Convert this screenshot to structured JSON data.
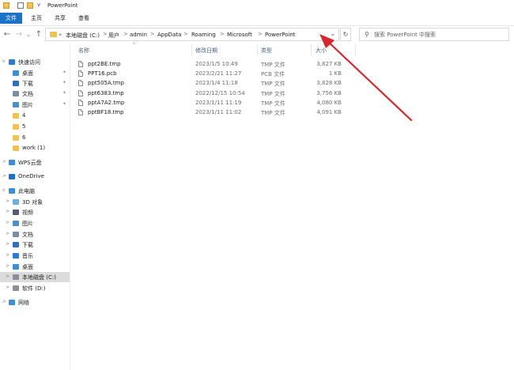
{
  "window": {
    "title": "PowerPoint",
    "qat_overflow": "v"
  },
  "ribbon": {
    "tabs": [
      {
        "label": "文件",
        "active": true
      },
      {
        "label": "主页",
        "active": false
      },
      {
        "label": "共享",
        "active": false
      },
      {
        "label": "查看",
        "active": false
      }
    ]
  },
  "address": {
    "prefix": "«",
    "crumbs": [
      "本地磁盘 (C:)",
      "用户",
      "admin",
      "AppData",
      "Roaming",
      "Microsoft",
      "PowerPoint"
    ],
    "separator": ">"
  },
  "search": {
    "placeholder": "搜索\"PowerPoint\"",
    "display": "搜索 PowerPoint 中搜索"
  },
  "sidebar": {
    "items": [
      {
        "label": "快速访问",
        "icon": "star-icon",
        "color": "#2b7bd8",
        "indent": 0,
        "pinned": false
      },
      {
        "label": "桌面",
        "icon": "desktop-icon",
        "color": "#3b8fd9",
        "indent": 1,
        "pinned": true
      },
      {
        "label": "下载",
        "icon": "download-icon",
        "color": "#2e6fc1",
        "indent": 1,
        "pinned": true
      },
      {
        "label": "文档",
        "icon": "document-icon",
        "color": "#7c8da6",
        "indent": 1,
        "pinned": true
      },
      {
        "label": "图片",
        "icon": "pictures-icon",
        "color": "#4a90c8",
        "indent": 1,
        "pinned": true
      },
      {
        "label": "4",
        "icon": "folder-icon",
        "color": "#f2c14e",
        "indent": 1,
        "pinned": false
      },
      {
        "label": "5",
        "icon": "folder-icon",
        "color": "#f2c14e",
        "indent": 1,
        "pinned": false
      },
      {
        "label": "6",
        "icon": "folder-icon",
        "color": "#f2c14e",
        "indent": 1,
        "pinned": false
      },
      {
        "label": "work (1)",
        "icon": "folder-icon",
        "color": "#f2c14e",
        "indent": 1,
        "pinned": false
      },
      {
        "label": "WPS云盘",
        "icon": "cloud-icon",
        "color": "#3a8de0",
        "indent": 0,
        "pinned": false
      },
      {
        "label": "OneDrive",
        "icon": "onedrive-icon",
        "color": "#1e6fd0",
        "indent": 0,
        "pinned": false
      },
      {
        "label": "此电脑",
        "icon": "computer-icon",
        "color": "#3b8fd9",
        "indent": 0,
        "pinned": false
      },
      {
        "label": "3D 对象",
        "icon": "3d-objects-icon",
        "color": "#6aaee6",
        "indent": 1,
        "pinned": false
      },
      {
        "label": "视频",
        "icon": "video-icon",
        "color": "#555d6b",
        "indent": 1,
        "pinned": false
      },
      {
        "label": "图片",
        "icon": "pictures-icon",
        "color": "#4a90c8",
        "indent": 1,
        "pinned": false
      },
      {
        "label": "文档",
        "icon": "document-icon",
        "color": "#7c8da6",
        "indent": 1,
        "pinned": false
      },
      {
        "label": "下载",
        "icon": "download-icon",
        "color": "#2e6fc1",
        "indent": 1,
        "pinned": false
      },
      {
        "label": "音乐",
        "icon": "music-icon",
        "color": "#2b7bd8",
        "indent": 1,
        "pinned": false
      },
      {
        "label": "桌面",
        "icon": "desktop-icon",
        "color": "#3b8fd9",
        "indent": 1,
        "pinned": false
      },
      {
        "label": "本地磁盘 (C:)",
        "icon": "drive-icon",
        "color": "#8a8f98",
        "indent": 1,
        "pinned": false,
        "selected": true
      },
      {
        "label": "软件 (D:)",
        "icon": "drive-icon",
        "color": "#8a8f98",
        "indent": 1,
        "pinned": false
      },
      {
        "label": "网络",
        "icon": "network-icon",
        "color": "#3b8fd9",
        "indent": 0,
        "pinned": false
      }
    ]
  },
  "list": {
    "columns": {
      "name": "名称",
      "date": "修改日期",
      "type": "类型",
      "size": "大小"
    },
    "rows": [
      {
        "name": "ppt2BE.tmp",
        "date": "2023/1/5 10:49",
        "type": "TMP 文件",
        "size": "3,827 KB"
      },
      {
        "name": "PPT16.pcb",
        "date": "2023/2/21 11:27",
        "type": "PCB 文件",
        "size": "1 KB"
      },
      {
        "name": "ppt505A.tmp",
        "date": "2023/1/4 11:18",
        "type": "TMP 文件",
        "size": "3,828 KB"
      },
      {
        "name": "ppt6383.tmp",
        "date": "2022/12/15 10:54",
        "type": "TMP 文件",
        "size": "3,756 KB"
      },
      {
        "name": "pptA7A2.tmp",
        "date": "2023/1/11 11:19",
        "type": "TMP 文件",
        "size": "4,080 KB"
      },
      {
        "name": "pptBF18.tmp",
        "date": "2023/1/11 11:02",
        "type": "TMP 文件",
        "size": "4,091 KB"
      }
    ]
  },
  "colors": {
    "accent": "#1a73c9",
    "annotation_arrow": "#d9272e",
    "selected_row": "#dcdcdc"
  }
}
